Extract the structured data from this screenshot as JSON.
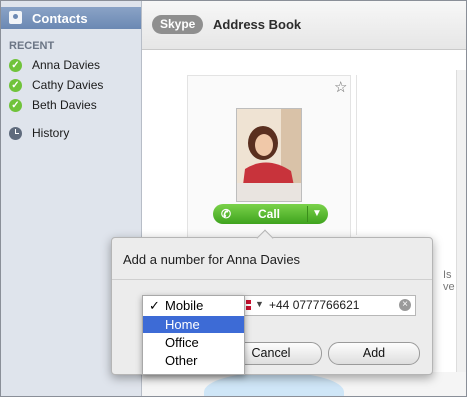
{
  "sidebar": {
    "contacts_label": "Contacts",
    "recent_header": "RECENT",
    "recent": [
      {
        "label": "Anna Davies"
      },
      {
        "label": "Cathy  Davies"
      },
      {
        "label": "Beth Davies"
      }
    ],
    "history_label": "History"
  },
  "header": {
    "skype_label": "Skype",
    "title": "Address Book"
  },
  "main": {
    "call_label": "Call",
    "partial_text": "Is ve"
  },
  "sheet": {
    "title": "Add a number for Anna Davies",
    "phone_value": "+44 0777766621",
    "cancel_label": "Cancel",
    "add_label": "Add"
  },
  "menu": {
    "items": [
      {
        "label": "Mobile",
        "checked": true
      },
      {
        "label": "Home",
        "highlighted": true
      },
      {
        "label": "Office"
      },
      {
        "label": "Other"
      }
    ]
  }
}
